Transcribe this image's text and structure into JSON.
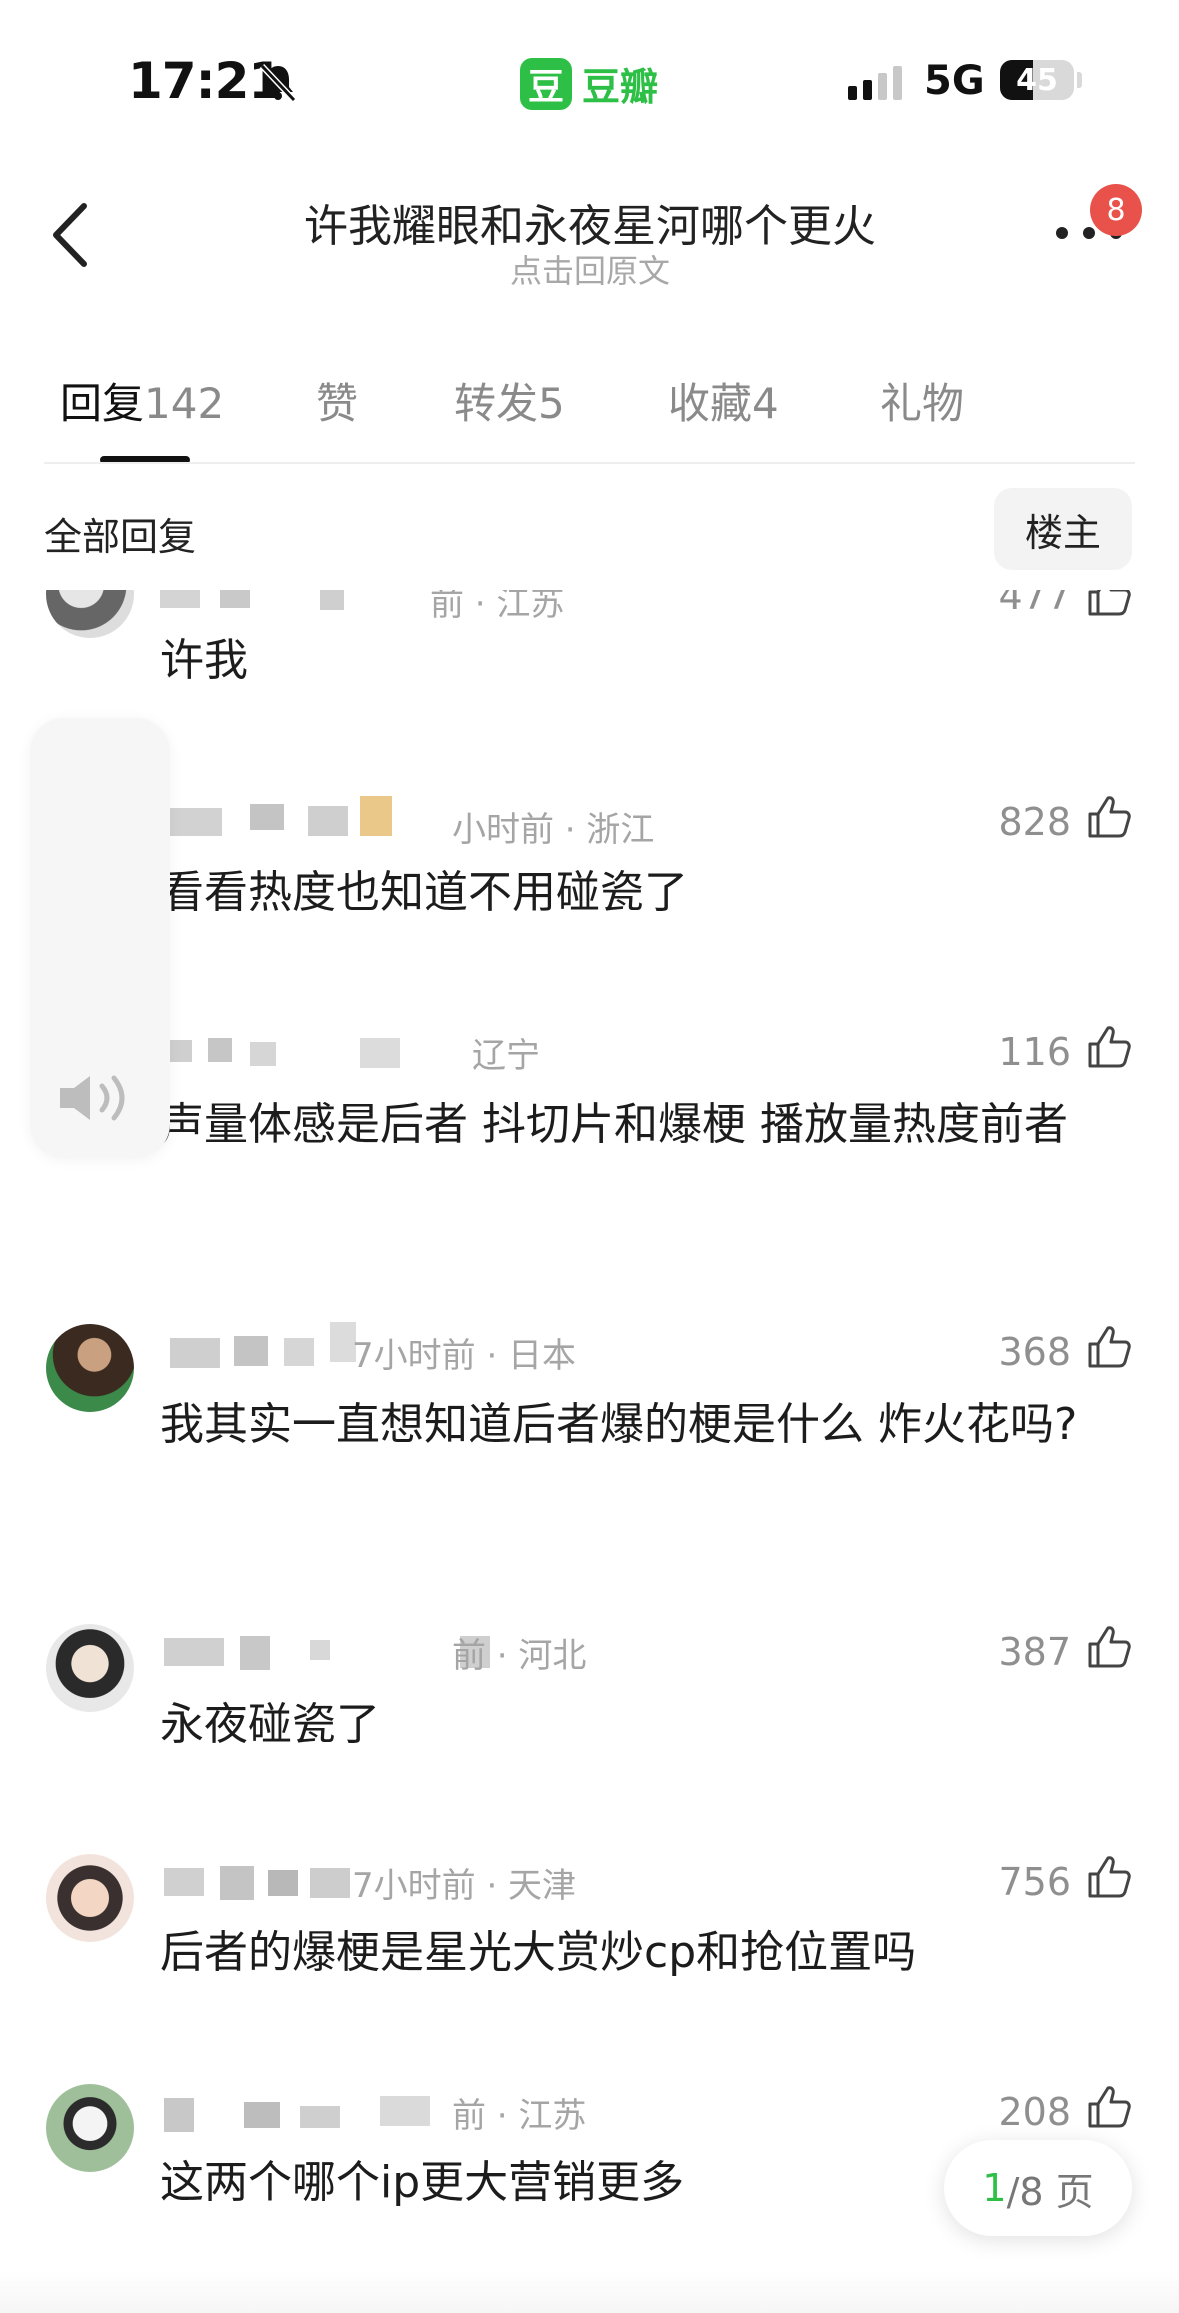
{
  "status_bar": {
    "time": "17:21",
    "app_logo": "豆",
    "app_name": "豆瓣",
    "network": "5G",
    "battery": "45",
    "battery_level_percent": 45,
    "signal_bars_filled": 2,
    "signal_bars_total": 4,
    "icons": [
      "bell-muted-icon",
      "signal-icon",
      "battery-icon"
    ]
  },
  "nav": {
    "title": "许我耀眼和永夜星河哪个更火",
    "subtitle": "点击回原文",
    "more_badge": "8",
    "icons": [
      "back-chevron-icon",
      "more-dots-icon"
    ]
  },
  "tabs": [
    {
      "label": "回复",
      "count": "142",
      "active": true
    },
    {
      "label": "赞",
      "count": "",
      "active": false
    },
    {
      "label": "转发",
      "count": "5",
      "active": false
    },
    {
      "label": "收藏",
      "count": "4",
      "active": false
    },
    {
      "label": "礼物",
      "count": "",
      "active": false
    }
  ],
  "filter": {
    "title": "全部回复",
    "op_button": "楼主"
  },
  "comments": [
    {
      "meta": "前 · 江苏",
      "likes": "477",
      "text": "许我"
    },
    {
      "meta": "小时前 · 浙江",
      "likes": "828",
      "text": "看看热度也知道不用碰瓷了"
    },
    {
      "meta": "辽宁",
      "likes": "116",
      "text": "声量体感是后者 抖切片和爆梗 播放量热度前者"
    },
    {
      "meta": "7小时前 · 日本",
      "likes": "368",
      "text": "我其实一直想知道后者爆的梗是什么 炸火花吗?"
    },
    {
      "meta": "前 · 河北",
      "likes": "387",
      "text": "永夜碰瓷了"
    },
    {
      "meta": "7小时前 · 天津",
      "likes": "756",
      "text": "后者的爆梗是星光大赏炒cp和抢位置吗"
    },
    {
      "meta": "前 · 江苏",
      "likes": "208",
      "text": "这两个哪个ip更大营销更多"
    }
  ],
  "pager": {
    "current": "1",
    "total": "/8 页"
  },
  "colors": {
    "brand_green": "#2dbf46",
    "badge_red": "#e9524a",
    "text_primary": "#1c1c1c",
    "text_secondary": "#a5a5a5"
  }
}
